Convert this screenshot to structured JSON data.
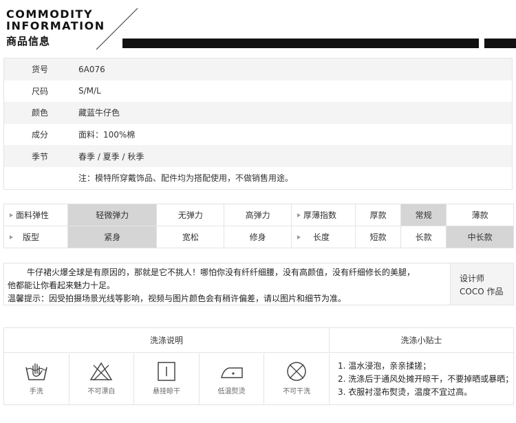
{
  "header": {
    "en_line1": "COMMODITY",
    "en_line2": "INFORMATION",
    "cn": "商品信息"
  },
  "info": [
    {
      "key": "货号",
      "value": "6A076"
    },
    {
      "key": "尺码",
      "value": "S/M/L"
    },
    {
      "key": "颜色",
      "value": "藏蓝牛仔色"
    },
    {
      "key": "成分",
      "value": "面料：100%棉"
    },
    {
      "key": "季节",
      "value": "春季 / 夏季 / 秋季"
    },
    {
      "key": "",
      "value": "注：模特所穿戴饰品、配件均为搭配使用，不做销售用途。"
    }
  ],
  "attributes": {
    "row1": {
      "label1": "面料弹性",
      "opts1": [
        "轻微弹力",
        "无弹力",
        "高弹力"
      ],
      "label2": "厚薄指数",
      "opts2": [
        "厚款",
        "常规",
        "薄款"
      ]
    },
    "row2": {
      "label1": "版型",
      "opts1": [
        "紧身",
        "宽松",
        "修身"
      ],
      "label2": "长度",
      "opts2": [
        "短款",
        "长款",
        "中长款"
      ]
    },
    "selected_color": "#d5d5d5"
  },
  "description": {
    "line1": "牛仔裙火爆全球是有原因的，那就是它不挑人！哪怕你没有纤纤细腰，没有高颜值，没有纤细修长的美腿，",
    "line2": "他都能让你看起来魅力十足。",
    "line3": "温馨提示：因受拍摄场景光线等影响，视频与图片颜色会有稍许偏差，请以图片和细节为准。",
    "designer_label": "设计师",
    "designer_name": "COCO 作品"
  },
  "wash": {
    "heading": "洗涤说明",
    "tips_heading": "洗涤小贴士",
    "icons": [
      {
        "icon": "hand-wash-icon",
        "label": "手洗"
      },
      {
        "icon": "no-bleach-icon",
        "label": "不可漂白"
      },
      {
        "icon": "hang-dry-icon",
        "label": "悬挂晾干"
      },
      {
        "icon": "low-iron-icon",
        "label": "低温熨烫"
      },
      {
        "icon": "no-dry-clean-icon",
        "label": "不可干洗"
      }
    ],
    "tips": [
      "1. 温水浸泡，亲亲揉搓；",
      "2. 洗涤后于通风处摊开晾干，不要掉晒或暴晒；",
      "3. 衣服衬湿布熨烫，温度不宜过高。"
    ]
  }
}
